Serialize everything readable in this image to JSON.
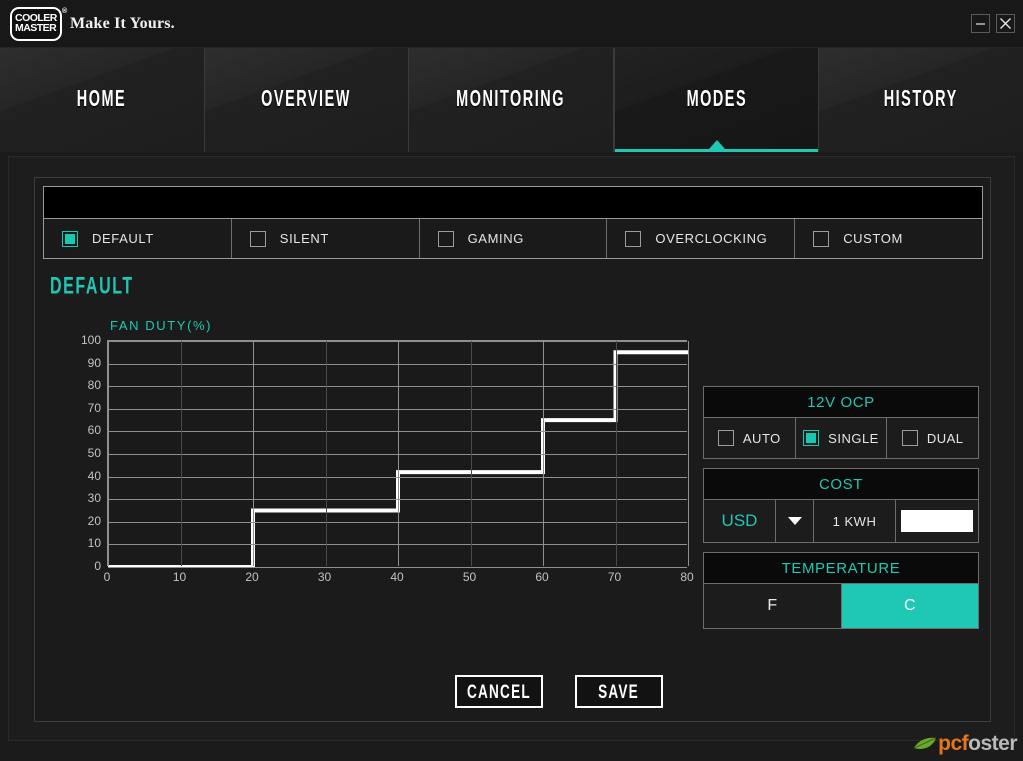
{
  "window": {
    "brand_line1": "COOLER",
    "brand_line2": "MASTER",
    "brand_reg": "®",
    "tagline": "Make It Yours.",
    "minimize_label": "Minimize",
    "close_label": "Close"
  },
  "nav": {
    "tabs": [
      {
        "label": "HOME",
        "active": false
      },
      {
        "label": "OVERVIEW",
        "active": false
      },
      {
        "label": "MONITORING",
        "active": false
      },
      {
        "label": "MODES",
        "active": true
      },
      {
        "label": "HISTORY",
        "active": false
      }
    ]
  },
  "modes": {
    "items": [
      {
        "label": "DEFAULT",
        "checked": true
      },
      {
        "label": "SILENT",
        "checked": false
      },
      {
        "label": "GAMING",
        "checked": false
      },
      {
        "label": "OVERCLOCKING",
        "checked": false
      },
      {
        "label": "CUSTOM",
        "checked": false
      }
    ]
  },
  "section": {
    "title": "DEFAULT"
  },
  "ocp": {
    "title": "12V OCP",
    "options": [
      {
        "label": "AUTO",
        "checked": false
      },
      {
        "label": "SINGLE",
        "checked": true
      },
      {
        "label": "DUAL",
        "checked": false
      }
    ]
  },
  "cost": {
    "title": "COST",
    "currency": "USD",
    "unit": "1 KWH",
    "rate_value": "",
    "rate_placeholder": ""
  },
  "temperature": {
    "title": "TEMPERATURE",
    "options": [
      {
        "label": "F",
        "selected": false
      },
      {
        "label": "C",
        "selected": true
      }
    ]
  },
  "buttons": {
    "cancel": "CANCEL",
    "save": "SAVE"
  },
  "watermark": {
    "part1": "pcf",
    "part2": "oster"
  },
  "colors": {
    "accent": "#1fc8b4",
    "curve": "#ffffff",
    "grid": "#8f8f8f",
    "panel_bg": "#1b1b1b"
  },
  "chart_data": {
    "type": "line",
    "title": "FAN DUTY(%)",
    "xlabel": "",
    "ylabel": "FAN DUTY(%)",
    "xlim": [
      0,
      80
    ],
    "ylim": [
      0,
      100
    ],
    "xticks": [
      0,
      10,
      20,
      30,
      40,
      50,
      60,
      70,
      80
    ],
    "yticks": [
      0,
      10,
      20,
      30,
      40,
      50,
      60,
      70,
      80,
      90,
      100
    ],
    "grid": true,
    "legend": "none",
    "step_type": "post",
    "series": [
      {
        "name": "Fan duty curve",
        "x": [
          0,
          20,
          20,
          40,
          40,
          60,
          60,
          70,
          70,
          80
        ],
        "y": [
          0,
          0,
          25,
          25,
          42,
          42,
          65,
          65,
          95,
          95
        ]
      }
    ],
    "steps": [
      {
        "x_start": 0,
        "x_end": 20,
        "duty": 0
      },
      {
        "x_start": 20,
        "x_end": 40,
        "duty": 25
      },
      {
        "x_start": 40,
        "x_end": 60,
        "duty": 42
      },
      {
        "x_start": 60,
        "x_end": 70,
        "duty": 65
      },
      {
        "x_start": 70,
        "x_end": 80,
        "duty": 95
      }
    ]
  }
}
